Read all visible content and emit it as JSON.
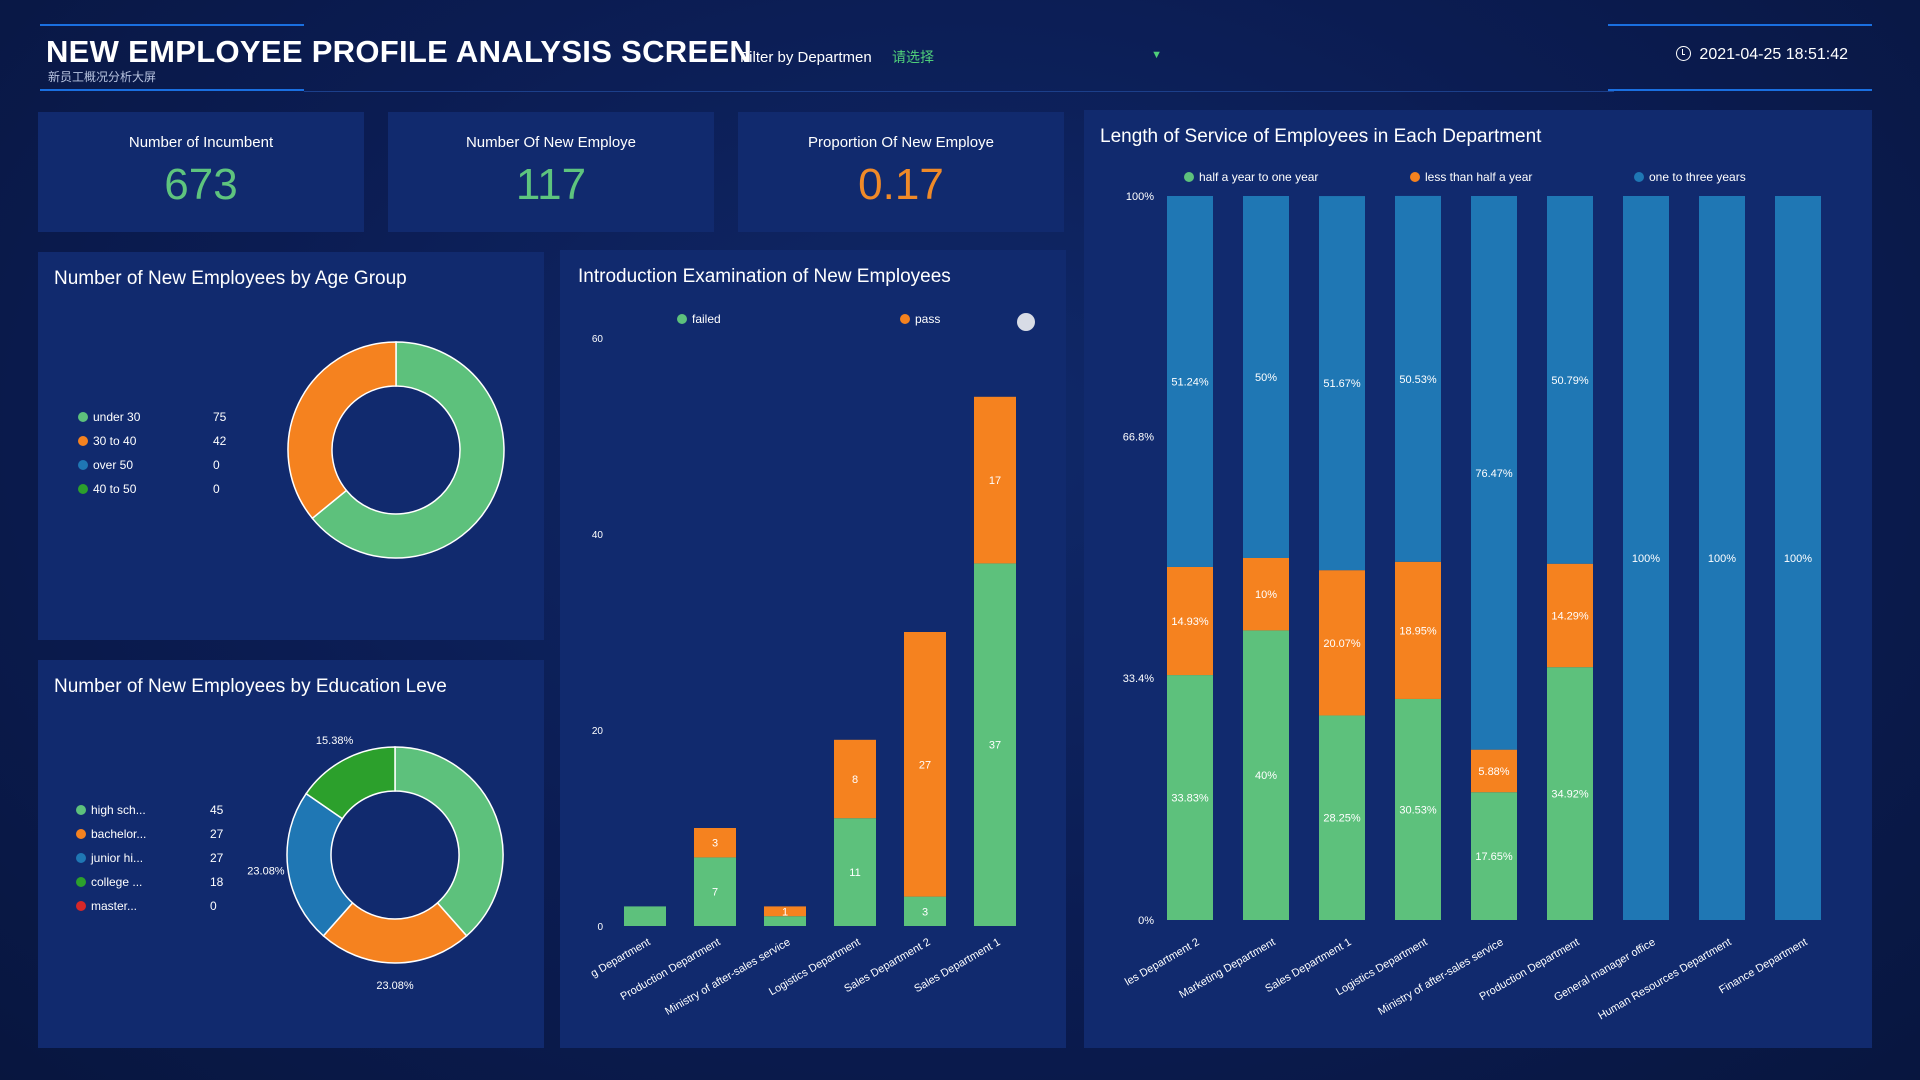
{
  "header": {
    "title": "NEW EMPLOYEE PROFILE ANALYSIS SCREEN",
    "subtitle": "新员工概况分析大屏",
    "filter_label": "Filter by Departmen",
    "filter_placeholder": "请选择",
    "datetime": "2021-04-25 18:51:42"
  },
  "kpis": [
    {
      "label": "Number of Incumbent",
      "value": "673",
      "color": "#5ec47e"
    },
    {
      "label": "Number Of New Employe",
      "value": "117",
      "color": "#5ec47e"
    },
    {
      "label": "Proportion Of New Employe",
      "value": "0.17",
      "color": "#f08a28"
    }
  ],
  "colors": {
    "green": "#5dc17c",
    "orange": "#f5821f",
    "blue": "#1f77b4",
    "darkgreen": "#2ca02c",
    "red": "#d62728"
  },
  "chart_data": [
    {
      "type": "pie",
      "title": "Number of New Employees by Age Group",
      "donut": true,
      "slices": [
        {
          "name": "under 30",
          "value": 75,
          "color": "#5dc17c"
        },
        {
          "name": "30 to 40",
          "value": 42,
          "color": "#f5821f"
        },
        {
          "name": "over 50",
          "value": 0,
          "color": "#1f77b4"
        },
        {
          "name": "40 to 50",
          "value": 0,
          "color": "#2ca02c"
        }
      ]
    },
    {
      "type": "pie",
      "title": "Number of New Employees by Education Leve",
      "donut": true,
      "slices": [
        {
          "name": "high sch...",
          "value": 45,
          "color": "#5dc17c",
          "label": ""
        },
        {
          "name": "bachelor...",
          "value": 27,
          "color": "#f5821f",
          "label": "23.08%"
        },
        {
          "name": "junior hi...",
          "value": 27,
          "color": "#1f77b4",
          "label": "23.08%"
        },
        {
          "name": "college ...",
          "value": 18,
          "color": "#2ca02c",
          "label": "15.38%"
        },
        {
          "name": "master...",
          "value": 0,
          "color": "#d62728",
          "label": ""
        }
      ]
    },
    {
      "type": "bar",
      "stacked": true,
      "title": "Introduction Examination of New Employees",
      "categories": [
        "g Department",
        "Production Department",
        "Ministry of after-sales service",
        "Logistics Department",
        "Sales Department 2",
        "Sales Department 1"
      ],
      "series": [
        {
          "name": "failed",
          "values": [
            2,
            7,
            1,
            11,
            3,
            37
          ],
          "color": "#5dc17c",
          "labels": [
            "",
            "7",
            "",
            "11",
            "3",
            "37"
          ]
        },
        {
          "name": "pass",
          "values": [
            0,
            3,
            1,
            8,
            27,
            17
          ],
          "color": "#f5821f",
          "labels": [
            "",
            "3",
            "1",
            "8",
            "27",
            "17"
          ]
        }
      ],
      "yticks": [
        0,
        20,
        40,
        60
      ],
      "ylim": [
        0,
        60
      ]
    },
    {
      "type": "bar",
      "stacked": true,
      "percent": true,
      "title": "Length of Service of Employees in Each Department",
      "categories": [
        "les Department 2",
        "Marketing Department",
        "Sales Department 1",
        "Logistics Department",
        "Ministry of after-sales service",
        "Production Department",
        "General manager office",
        "Human Resources Department",
        "Finance Department"
      ],
      "series": [
        {
          "name": "half a year to one year",
          "values": [
            33.83,
            40,
            28.25,
            30.53,
            17.65,
            34.92,
            0,
            0,
            0
          ],
          "color": "#5dc17c",
          "labels": [
            "33.83%",
            "40%",
            "28.25%",
            "30.53%",
            "17.65%",
            "34.92%",
            "",
            "",
            ""
          ]
        },
        {
          "name": "less than half a year",
          "values": [
            14.93,
            10,
            20.07,
            18.95,
            5.88,
            14.29,
            0,
            0,
            0
          ],
          "color": "#f5821f",
          "labels": [
            "14.93%",
            "10%",
            "20.07%",
            "18.95%",
            "5.88%",
            "14.29%",
            "",
            "",
            ""
          ]
        },
        {
          "name": "one to three years",
          "values": [
            51.24,
            50,
            51.67,
            50.53,
            76.47,
            50.79,
            100,
            100,
            100
          ],
          "color": "#1f77b4",
          "labels": [
            "51.24%",
            "50%",
            "51.67%",
            "50.53%",
            "76.47%",
            "50.79%",
            "100%",
            "100%",
            "100%"
          ]
        }
      ],
      "yticks": [
        "0%",
        "33.4%",
        "66.8%",
        "100%"
      ],
      "ylim": [
        0,
        100
      ]
    }
  ]
}
